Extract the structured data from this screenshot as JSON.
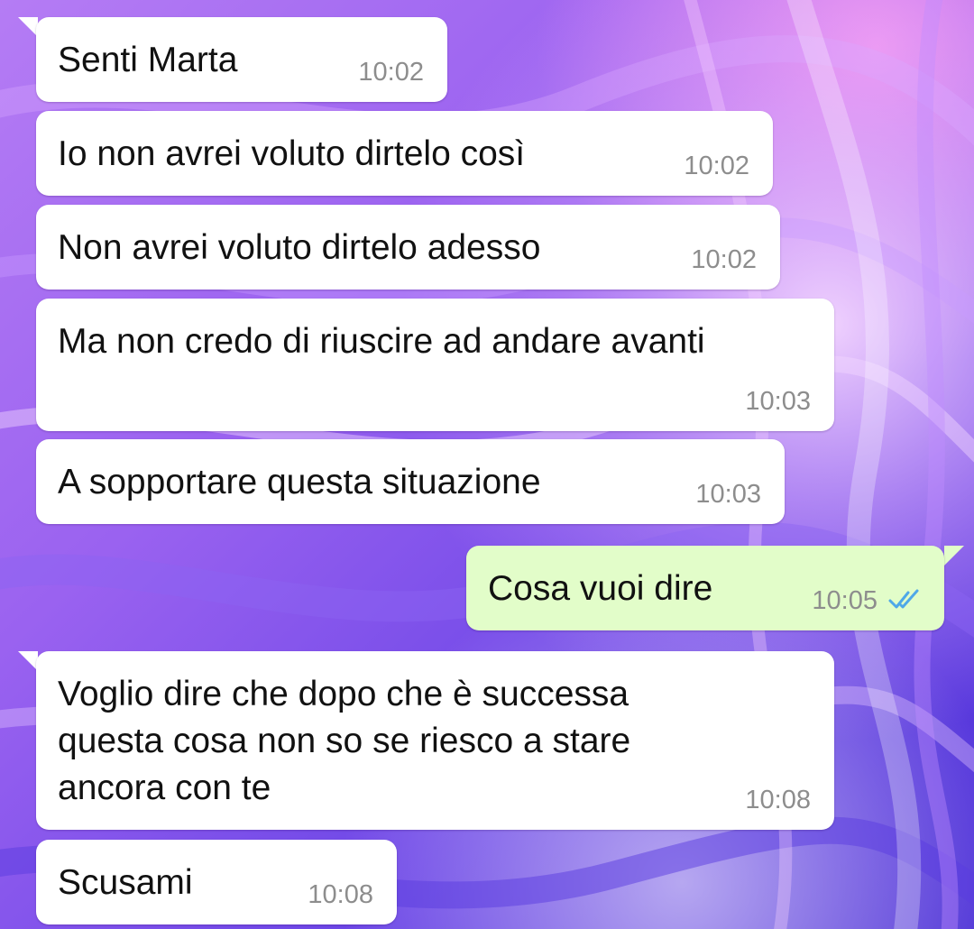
{
  "colors": {
    "incoming_bubble": "#ffffff",
    "outgoing_bubble": "#e2fdc9",
    "read_ticks": "#4fa8e8",
    "timestamp": "#8d8d8d"
  },
  "messages": [
    {
      "direction": "incoming",
      "text": "Senti Marta",
      "time": "10:02"
    },
    {
      "direction": "incoming",
      "text": "Io non avrei voluto dirtelo così",
      "time": "10:02"
    },
    {
      "direction": "incoming",
      "text": "Non avrei voluto dirtelo adesso",
      "time": "10:02"
    },
    {
      "direction": "incoming",
      "text": "Ma non credo di riuscire ad andare avanti",
      "time": "10:03"
    },
    {
      "direction": "incoming",
      "text": "A sopportare questa situazione",
      "time": "10:03"
    },
    {
      "direction": "outgoing",
      "text": "Cosa vuoi dire",
      "time": "10:05",
      "status_icon": "double-check-icon"
    },
    {
      "direction": "incoming",
      "text": "Voglio dire che dopo che è successa\nquesta cosa non so se riesco a stare\nancora con te",
      "time": "10:08"
    },
    {
      "direction": "incoming",
      "text": "Scusami",
      "time": "10:08"
    }
  ]
}
